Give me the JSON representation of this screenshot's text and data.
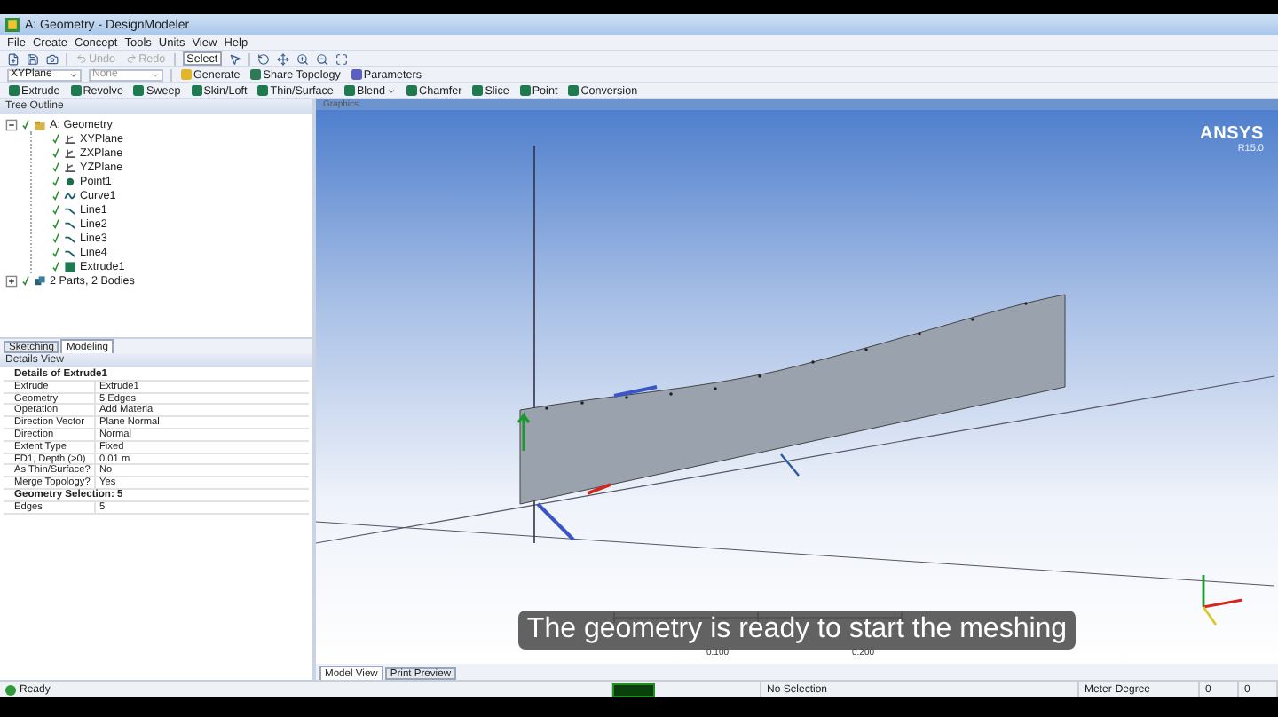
{
  "window": {
    "title": "A: Geometry - DesignModeler"
  },
  "menu": [
    "File",
    "Create",
    "Concept",
    "Tools",
    "Units",
    "View",
    "Help"
  ],
  "toolbar": {
    "undo": {
      "label": "Undo",
      "disabled": true
    },
    "redo": {
      "label": "Redo",
      "disabled": true
    },
    "select": "Select"
  },
  "plane_toolbar": {
    "plane": "XYPlane",
    "sketch": "None",
    "buttons": [
      "Generate",
      "Share Topology",
      "Parameters"
    ]
  },
  "feature_toolbar": [
    {
      "label": "Extrude",
      "dropdown": false
    },
    {
      "label": "Revolve",
      "dropdown": false
    },
    {
      "label": "Sweep",
      "dropdown": false
    },
    {
      "label": "Skin/Loft",
      "dropdown": false
    },
    {
      "label": "Thin/Surface",
      "dropdown": false
    },
    {
      "label": "Blend",
      "dropdown": true
    },
    {
      "label": "Chamfer",
      "dropdown": false
    },
    {
      "label": "Slice",
      "dropdown": false
    },
    {
      "label": "Point",
      "dropdown": false
    },
    {
      "label": "Conversion",
      "dropdown": false
    }
  ],
  "tree_outline": {
    "title": "Tree Outline",
    "items": [
      {
        "label": "A: Geometry",
        "kind": "root",
        "expanded": true,
        "children": [
          {
            "label": "XYPlane",
            "kind": "plane"
          },
          {
            "label": "ZXPlane",
            "kind": "plane"
          },
          {
            "label": "YZPlane",
            "kind": "plane"
          },
          {
            "label": "Point1",
            "kind": "point"
          },
          {
            "label": "Curve1",
            "kind": "curve"
          },
          {
            "label": "Line1",
            "kind": "line"
          },
          {
            "label": "Line2",
            "kind": "line"
          },
          {
            "label": "Line3",
            "kind": "line"
          },
          {
            "label": "Line4",
            "kind": "line"
          },
          {
            "label": "Extrude1",
            "kind": "extrude"
          }
        ]
      },
      {
        "label": "2 Parts, 2 Bodies",
        "kind": "parts",
        "expanded": false
      }
    ]
  },
  "mode_tabs": [
    {
      "label": "Sketching",
      "selected": false
    },
    {
      "label": "Modeling",
      "selected": true
    }
  ],
  "details": {
    "title": "Details View",
    "rows": [
      {
        "kind": "section",
        "label": "Details of Extrude1"
      },
      {
        "kind": "row",
        "label": "Extrude",
        "value": "Extrude1"
      },
      {
        "kind": "row",
        "label": "Geometry",
        "value": "5 Edges"
      },
      {
        "kind": "row",
        "label": "Operation",
        "value": "Add Material"
      },
      {
        "kind": "row",
        "label": "Direction Vector",
        "value": "Plane Normal"
      },
      {
        "kind": "row",
        "label": "Direction",
        "value": "Normal"
      },
      {
        "kind": "row",
        "label": "Extent Type",
        "value": "Fixed"
      },
      {
        "kind": "row",
        "label": "FD1, Depth (>0)",
        "value": "0.01 m"
      },
      {
        "kind": "row",
        "label": "As Thin/Surface?",
        "value": "No"
      },
      {
        "kind": "row",
        "label": "Merge Topology?",
        "value": "Yes"
      },
      {
        "kind": "section",
        "label": "Geometry Selection: 5"
      },
      {
        "kind": "row",
        "label": "Edges",
        "value": "5"
      }
    ]
  },
  "graphics": {
    "title": "Graphics",
    "logo": "ANSYS",
    "version": "R15.0",
    "scale_labels": [
      "0.100",
      "0.200"
    ]
  },
  "caption": "The geometry is ready to start the meshing",
  "view_tabs": [
    {
      "label": "Model View",
      "selected": true
    },
    {
      "label": "Print Preview",
      "selected": false
    }
  ],
  "status_bar": {
    "message": "Ready",
    "selection": "No Selection",
    "length_unit": "Meter",
    "angle_unit": "Degree",
    "fields": [
      "0",
      "0"
    ]
  }
}
